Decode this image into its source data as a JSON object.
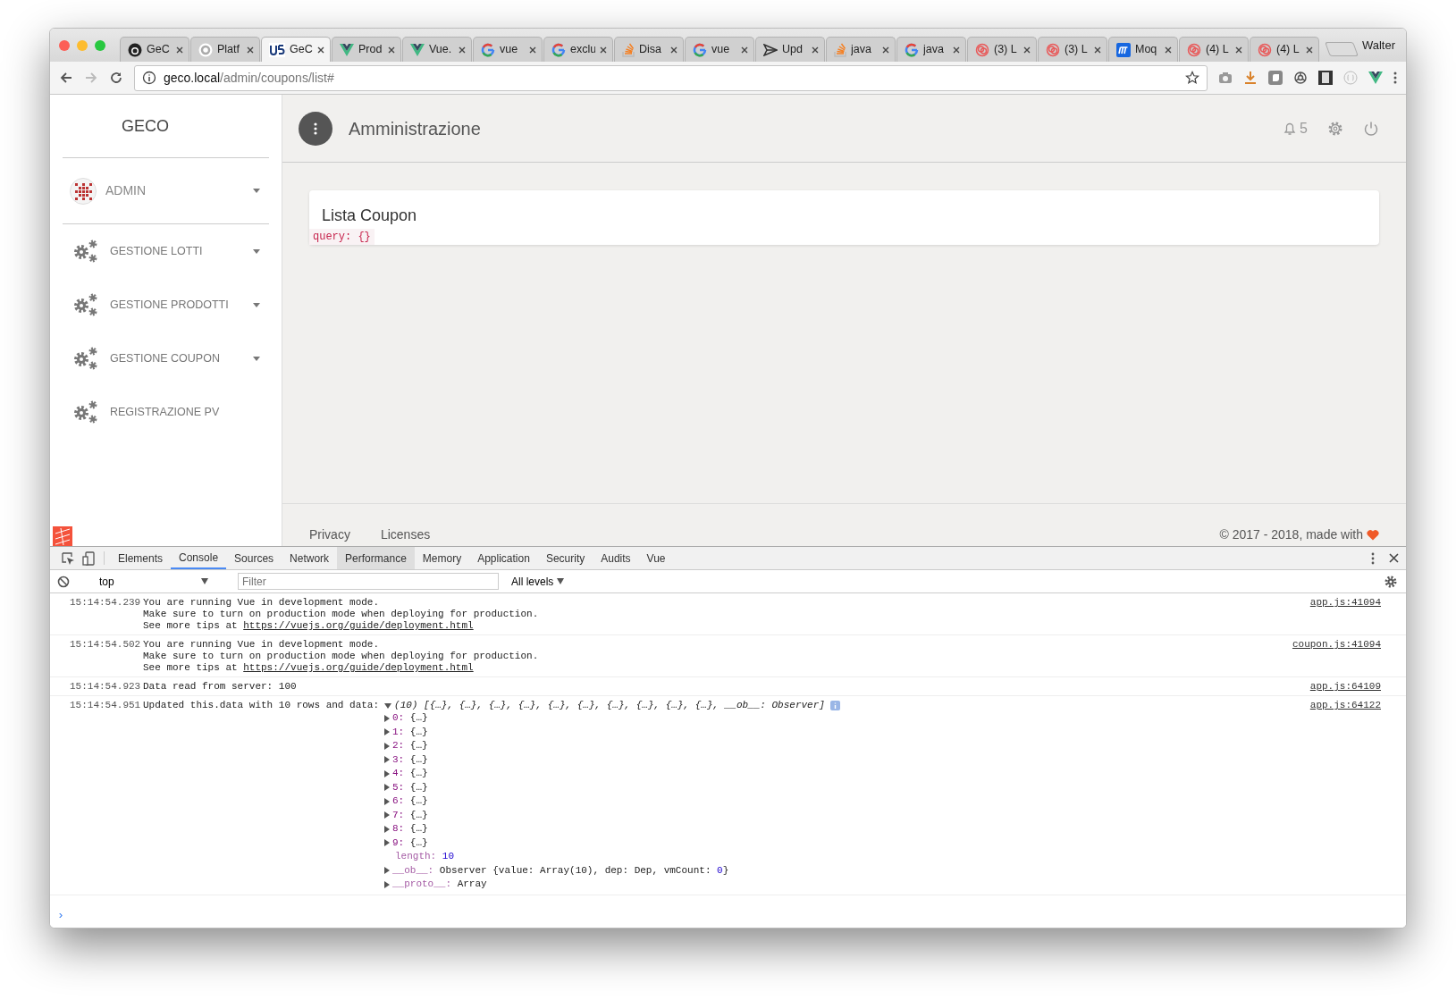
{
  "browser": {
    "user": "Walter",
    "tabs": [
      {
        "title": "GeC",
        "kind": "octocat",
        "selected": false
      },
      {
        "title": "Platf",
        "kind": "ring",
        "selected": false
      },
      {
        "title": "GeC",
        "kind": "u5",
        "selected": true
      },
      {
        "title": "Prod",
        "kind": "vue",
        "selected": false
      },
      {
        "title": "Vue.",
        "kind": "vue",
        "selected": false
      },
      {
        "title": "vue",
        "kind": "google",
        "selected": false
      },
      {
        "title": "exclu",
        "kind": "google",
        "selected": false
      },
      {
        "title": "Disa",
        "kind": "stack",
        "selected": false
      },
      {
        "title": "vue",
        "kind": "google",
        "selected": false
      },
      {
        "title": "Upd",
        "kind": "send",
        "selected": false
      },
      {
        "title": "java",
        "kind": "stack",
        "selected": false
      },
      {
        "title": "java",
        "kind": "google",
        "selected": false
      },
      {
        "title": "(3) L",
        "kind": "spiral",
        "selected": false
      },
      {
        "title": "(3) L",
        "kind": "spiral",
        "selected": false
      },
      {
        "title": "Moq",
        "kind": "moqups",
        "selected": false
      },
      {
        "title": "(4) L",
        "kind": "spiral",
        "selected": false
      },
      {
        "title": "(4) L",
        "kind": "spiral",
        "selected": false
      }
    ],
    "address": {
      "host": "geco.local",
      "path": "/admin/coupons/list#"
    }
  },
  "sidebar": {
    "brand": "GECO",
    "user": "ADMIN",
    "items": [
      {
        "label": "GESTIONE LOTTI",
        "expandable": true
      },
      {
        "label": "GESTIONE PRODOTTI",
        "expandable": true
      },
      {
        "label": "GESTIONE COUPON",
        "expandable": true
      },
      {
        "label": "REGISTRAZIONE PV",
        "expandable": false
      }
    ]
  },
  "header": {
    "title": "Amministrazione",
    "notifications": "5"
  },
  "card": {
    "title": "Lista Coupon",
    "code": "query: {}"
  },
  "footer": {
    "links": [
      "Privacy",
      "Licenses"
    ],
    "copyright": "© 2017 - 2018, made with"
  },
  "devtools": {
    "tabs": [
      {
        "label": "Elements",
        "selected": false,
        "hovered": false
      },
      {
        "label": "Console",
        "selected": true,
        "hovered": false
      },
      {
        "label": "Sources",
        "selected": false,
        "hovered": false
      },
      {
        "label": "Network",
        "selected": false,
        "hovered": false
      },
      {
        "label": "Performance",
        "selected": false,
        "hovered": true
      },
      {
        "label": "Memory",
        "selected": false,
        "hovered": false
      },
      {
        "label": "Application",
        "selected": false,
        "hovered": false
      },
      {
        "label": "Security",
        "selected": false,
        "hovered": false
      },
      {
        "label": "Audits",
        "selected": false,
        "hovered": false
      },
      {
        "label": "Vue",
        "selected": false,
        "hovered": false
      }
    ],
    "context": "top",
    "filter_placeholder": "Filter",
    "levels": "All levels",
    "messages": [
      {
        "kind": "text",
        "time": "15:14:54.239",
        "lines": [
          "You are running Vue in development mode.",
          "Make sure to turn on production mode when deploying for production."
        ],
        "tip": "See more tips at",
        "link": "https://vuejs.org/guide/deployment.html",
        "source": "app.js:41094"
      },
      {
        "kind": "text",
        "time": "15:14:54.502",
        "lines": [
          "You are running Vue in development mode.",
          "Make sure to turn on production mode when deploying for production."
        ],
        "tip": "See more tips at",
        "link": "https://vuejs.org/guide/deployment.html",
        "source": "coupon.js:41094"
      },
      {
        "kind": "text",
        "time": "15:14:54.923",
        "lines": [
          "Data read from server: 100"
        ],
        "source": "app.js:64109"
      },
      {
        "kind": "object",
        "time": "15:14:54.951",
        "text": "Updated this.data with 10 rows and data:",
        "expanded": true,
        "summary": "(10) [{…}, {…}, {…}, {…}, {…}, {…}, {…}, {…}, {…}, {…}, __ob__: Observer]",
        "source": "app.js:64122",
        "entries": [
          {
            "key": "0:",
            "kind": "index",
            "expandable": true,
            "value": [
              {
                "text": "{…}",
                "kind": "plain"
              }
            ]
          },
          {
            "key": "1:",
            "kind": "index",
            "expandable": true,
            "value": [
              {
                "text": "{…}",
                "kind": "plain"
              }
            ]
          },
          {
            "key": "2:",
            "kind": "index",
            "expandable": true,
            "value": [
              {
                "text": "{…}",
                "kind": "plain"
              }
            ]
          },
          {
            "key": "3:",
            "kind": "index",
            "expandable": true,
            "value": [
              {
                "text": "{…}",
                "kind": "plain"
              }
            ]
          },
          {
            "key": "4:",
            "kind": "index",
            "expandable": true,
            "value": [
              {
                "text": "{…}",
                "kind": "plain"
              }
            ]
          },
          {
            "key": "5:",
            "kind": "index",
            "expandable": true,
            "value": [
              {
                "text": "{…}",
                "kind": "plain"
              }
            ]
          },
          {
            "key": "6:",
            "kind": "index",
            "expandable": true,
            "value": [
              {
                "text": "{…}",
                "kind": "plain"
              }
            ]
          },
          {
            "key": "7:",
            "kind": "index",
            "expandable": true,
            "value": [
              {
                "text": "{…}",
                "kind": "plain"
              }
            ]
          },
          {
            "key": "8:",
            "kind": "index",
            "expandable": true,
            "value": [
              {
                "text": "{…}",
                "kind": "plain"
              }
            ]
          },
          {
            "key": "9:",
            "kind": "index",
            "expandable": true,
            "value": [
              {
                "text": "{…}",
                "kind": "plain"
              }
            ]
          },
          {
            "key": "length:",
            "kind": "internal",
            "expandable": false,
            "value": [
              {
                "text": "10",
                "kind": "number"
              }
            ]
          },
          {
            "key": "__ob__:",
            "kind": "internal",
            "expandable": true,
            "value": [
              {
                "text": "Observer {value: Array(10), dep: Dep, vmCount: ",
                "kind": "plain"
              },
              {
                "text": "0",
                "kind": "number"
              },
              {
                "text": "}",
                "kind": "plain"
              }
            ]
          },
          {
            "key": "__proto__:",
            "kind": "internal",
            "expandable": true,
            "value": [
              {
                "text": "Array",
                "kind": "plain"
              }
            ]
          }
        ]
      }
    ],
    "prompt": "›"
  }
}
